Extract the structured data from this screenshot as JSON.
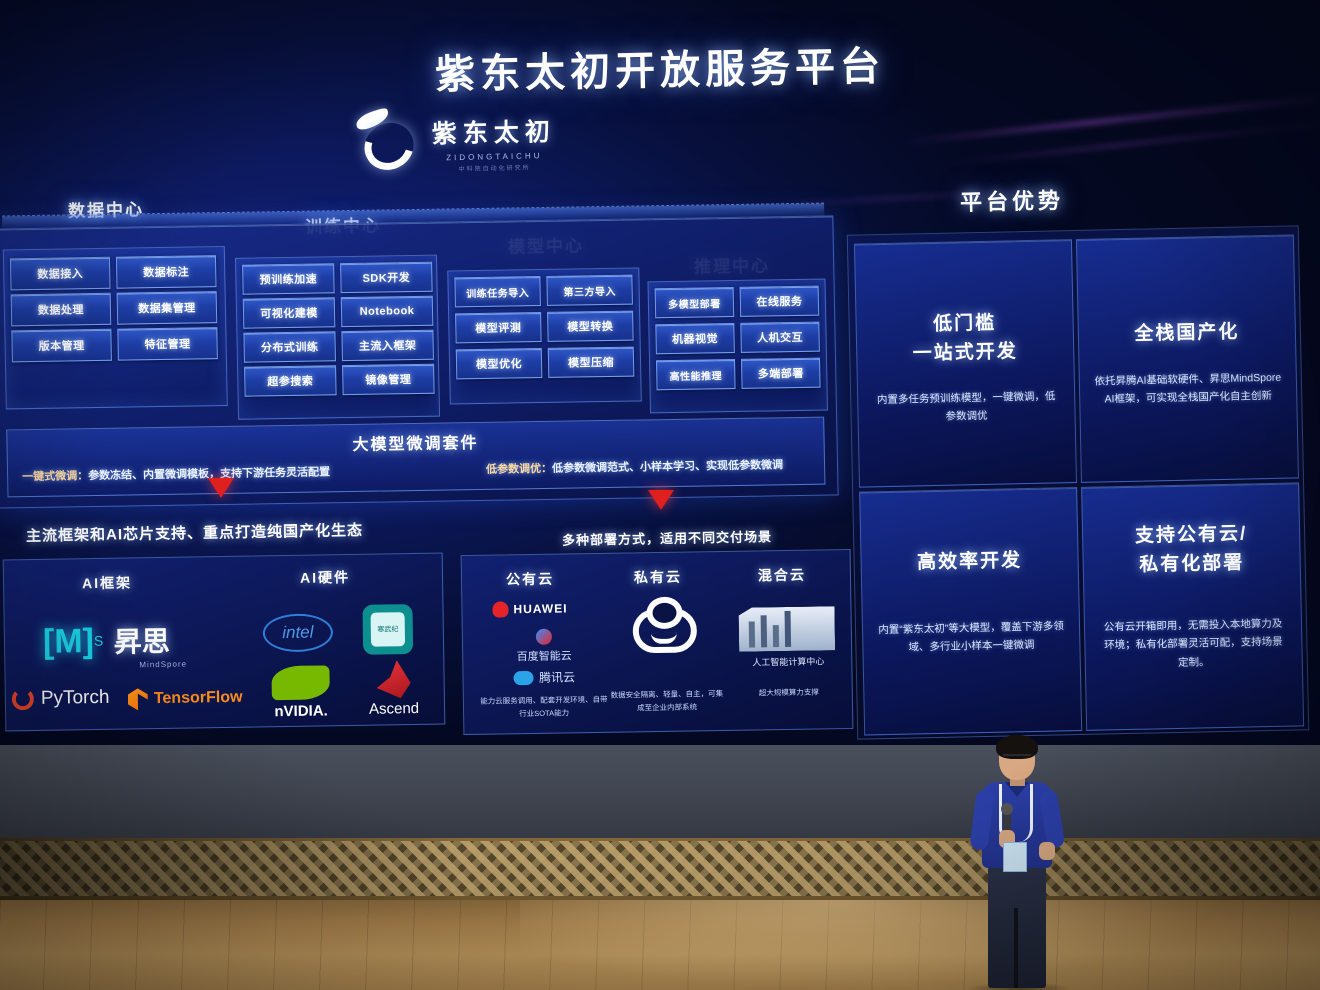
{
  "slide": {
    "title": "紫东太初开放服务平台",
    "brand": {
      "cn": "紫东太初",
      "en": "ZIDONGTAICHU",
      "sub": "中科院自动化研究所"
    }
  },
  "sections": [
    {
      "name": "data-center",
      "header": "数据中心",
      "items": [
        "数据接入",
        "数据标注",
        "数据处理",
        "数据集管理",
        "版本管理",
        "特征管理"
      ]
    },
    {
      "name": "training-center",
      "header": "训练中心",
      "items": [
        "预训练加速",
        "SDK开发",
        "可视化建模",
        "Notebook",
        "分布式训练",
        "主流入框架",
        "超参搜索",
        "镜像管理"
      ]
    },
    {
      "name": "model-center",
      "header": "模型中心",
      "items": [
        "训练任务导入",
        "第三方导入",
        "模型评测",
        "模型转换",
        "模型优化",
        "模型压缩"
      ]
    },
    {
      "name": "inference-center",
      "header": "推理中心",
      "items": [
        "多模型部署",
        "在线服务",
        "机器视觉",
        "人机交互",
        "高性能推理",
        "多端部署"
      ]
    }
  ],
  "finetune": {
    "title": "大模型微调套件",
    "left_key": "一键式微调：",
    "left_text": "参数冻结、内置微调模板，支持下游任务灵活配置",
    "right_key": "低参数调优：",
    "right_text": "低参数微调范式、小样本学习、实现低参数微调"
  },
  "banners": {
    "left": "主流框架和AI芯片支持、重点打造纯国产化生态",
    "right": "多种部署方式，适用不同交付场景"
  },
  "frameworks": {
    "header": "AI框架",
    "logos": [
      {
        "name": "mindspore-logo",
        "label": "[M]",
        "sup": "S",
        "cn": "昇思",
        "en": "MindSpore"
      },
      {
        "name": "pytorch-logo",
        "label": "PyTorch"
      },
      {
        "name": "tensorflow-logo",
        "label": "TensorFlow"
      }
    ]
  },
  "hardware": {
    "header": "AI硬件",
    "logos": [
      {
        "name": "intel-logo",
        "label": "intel"
      },
      {
        "name": "cambricon-logo",
        "label": "寒武纪"
      },
      {
        "name": "nvidia-logo",
        "label": "nVIDIA."
      },
      {
        "name": "ascend-logo",
        "label": "Ascend"
      }
    ]
  },
  "cloud": {
    "columns": [
      {
        "name": "public-cloud",
        "header": "公有云",
        "logos": [
          "HUAWEI",
          "百度智能云",
          "腾讯云"
        ],
        "desc": "能力云服务调用、配套开发环境、自带行业SOTA能力"
      },
      {
        "name": "private-cloud",
        "header": "私有云",
        "logos": [],
        "desc": "数据安全隔离、轻量、自主，可集成至企业内部系统"
      },
      {
        "name": "hybrid-cloud",
        "header": "混合云",
        "logos": [
          "人工智能计算中心"
        ],
        "desc": "超大规模算力支撑"
      }
    ]
  },
  "advantages": {
    "title": "平台优势",
    "cards": [
      {
        "name": "low-barrier",
        "heading": "低门槛\n一站式开发",
        "body": "内置多任务预训练模型，一键微调，低参数调优"
      },
      {
        "name": "full-stack-domestic",
        "heading": "全栈国产化",
        "body": "依托昇腾AI基础软硬件、昇思MindSpore AI框架，可实现全栈国产化自主创新"
      },
      {
        "name": "high-efficiency",
        "heading": "高效率开发",
        "body": "内置“紫东太初”等大模型，覆盖下游多领域、多行业小样本一键微调"
      },
      {
        "name": "cloud-deploy",
        "heading": "支持公有云/\n私有化部署",
        "body": "公有云开箱即用，无需投入本地算力及环境；私有化部署灵活可配，支持场景定制。"
      }
    ]
  },
  "scene": {
    "speaker": "presenter-with-microphone",
    "stage": "conference-stage"
  }
}
